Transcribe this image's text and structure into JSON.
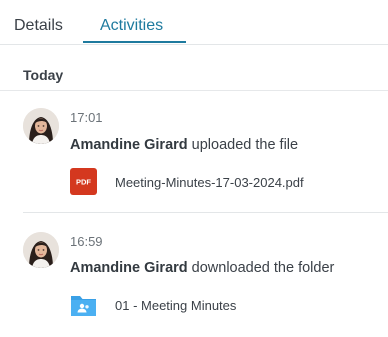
{
  "tabs": [
    {
      "label": "Details"
    },
    {
      "label": "Activities"
    }
  ],
  "section": {
    "title": "Today"
  },
  "activities": [
    {
      "time": "17:01",
      "actor": "Amandine Girard",
      "action": " uploaded the file",
      "item": {
        "icon": "pdf-file-icon",
        "icon_text": "PDF",
        "name": "Meeting-Minutes-17-03-2024.pdf"
      }
    },
    {
      "time": "16:59",
      "actor": "Amandine Girard",
      "action": " downloaded the folder",
      "item": {
        "icon": "shared-folder-icon",
        "name": "01 - Meeting Minutes"
      }
    }
  ],
  "colors": {
    "accent": "#1e7a9e",
    "pdf_red": "#d4381f",
    "folder_blue": "#3aa0e6"
  }
}
